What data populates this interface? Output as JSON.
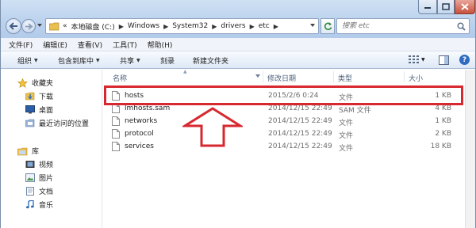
{
  "window": {
    "controls": {
      "minimize": "minimize",
      "maximize": "maximize",
      "close": "close"
    }
  },
  "address": {
    "overflow": "«",
    "crumbs": [
      "本地磁盘 (C:)",
      "Windows",
      "System32",
      "drivers",
      "etc"
    ]
  },
  "search": {
    "placeholder": "搜索 etc"
  },
  "menu": [
    "文件(F)",
    "编辑(E)",
    "查看(V)",
    "工具(T)",
    "帮助(H)"
  ],
  "toolbar": {
    "organize": "组织",
    "include_in_library": "包含到库中",
    "share": "共享",
    "burn": "刻录",
    "new_folder": "新建文件夹"
  },
  "navigation": {
    "favorites": {
      "label": "收藏夹",
      "items": [
        "下载",
        "桌面",
        "最近访问的位置"
      ]
    },
    "libraries": {
      "label": "库",
      "items": [
        "视频",
        "图片",
        "文档",
        "音乐"
      ]
    }
  },
  "columns": {
    "name": "名称",
    "modified": "修改日期",
    "type": "类型",
    "size": "大小"
  },
  "files": [
    {
      "name": "hosts",
      "modified": "2015/2/6 0:24",
      "type": "文件",
      "size": "1 KB"
    },
    {
      "name": "lmhosts.sam",
      "modified": "2014/12/15 22:49",
      "type": "SAM 文件",
      "size": "4 KB"
    },
    {
      "name": "networks",
      "modified": "2014/12/15 22:49",
      "type": "文件",
      "size": "1 KB"
    },
    {
      "name": "protocol",
      "modified": "2014/12/15 22:49",
      "type": "文件",
      "size": "2 KB"
    },
    {
      "name": "services",
      "modified": "2014/12/15 22:49",
      "type": "文件",
      "size": "18 KB"
    }
  ],
  "colors": {
    "highlight": "#d7282f",
    "toolbar": "#dde8f6",
    "folder": "#e9bf4f"
  },
  "annotation": {
    "highlighted_file": "hosts"
  }
}
